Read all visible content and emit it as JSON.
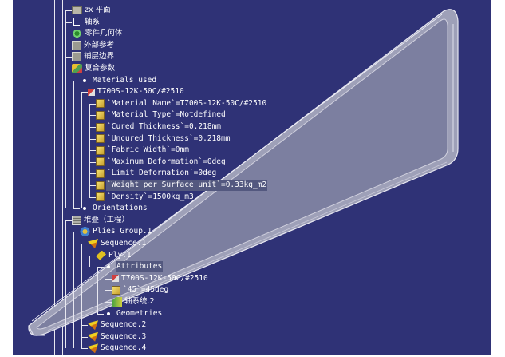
{
  "tree": {
    "nodes": [
      {
        "id": "zx-plane",
        "label": "zx 平面",
        "icon": "plane-icon",
        "indent": 0,
        "cn": true
      },
      {
        "id": "axis-system",
        "label": "轴系",
        "icon": "axis-icon",
        "indent": 0,
        "cn": true
      },
      {
        "id": "part-geometry",
        "label": "零件几何体",
        "icon": "gear-icon",
        "indent": 0,
        "cn": true
      },
      {
        "id": "external-refs",
        "label": "外部参考",
        "icon": "box-icon",
        "indent": 0,
        "cn": true
      },
      {
        "id": "ply-boundary",
        "label": "铺层边界",
        "icon": "box-icon",
        "indent": 0,
        "cn": true
      },
      {
        "id": "composite-params",
        "label": "复合参数",
        "icon": "composite-icon",
        "indent": 0,
        "cn": true
      },
      {
        "id": "materials-used",
        "label": "Materials used",
        "icon": "dot-icon",
        "indent": 1
      },
      {
        "id": "material-t700s",
        "label": "T700S-12K-50C/#2510",
        "icon": "material-icon",
        "indent": 2
      },
      {
        "id": "param-name",
        "label": "`Material Name`=T700S-12K-50C/#2510",
        "icon": "parameter-icon",
        "indent": 3
      },
      {
        "id": "param-type",
        "label": "`Material Type`=Notdefined",
        "icon": "parameter-icon",
        "indent": 3
      },
      {
        "id": "param-cured",
        "label": "`Cured Thickness`=0.218mm",
        "icon": "parameter-icon",
        "indent": 3
      },
      {
        "id": "param-uncured",
        "label": "`Uncured Thickness`=0.218mm",
        "icon": "parameter-icon",
        "indent": 3
      },
      {
        "id": "param-width",
        "label": "`Fabric Width`=0mm",
        "icon": "parameter-icon",
        "indent": 3
      },
      {
        "id": "param-maxdef",
        "label": "`Maximum Deformation`=0deg",
        "icon": "parameter-icon",
        "indent": 3
      },
      {
        "id": "param-limdef",
        "label": "`Limit Deformation`=0deg",
        "icon": "parameter-icon",
        "indent": 3
      },
      {
        "id": "param-weight",
        "label": "`Weight per Surface unit`=0.33kg_m2",
        "icon": "parameter-icon",
        "indent": 3,
        "selected": true
      },
      {
        "id": "param-density",
        "label": "`Density`=1500kg_m3",
        "icon": "parameter-icon",
        "indent": 3
      },
      {
        "id": "orientations",
        "label": "Orientations",
        "icon": "dot-icon",
        "indent": 1
      },
      {
        "id": "stacking",
        "label": "堆叠（工程）",
        "icon": "stack-icon",
        "indent": 0,
        "cn": true
      },
      {
        "id": "plies-group",
        "label": "Plies Group.1",
        "icon": "group-icon",
        "indent": 1
      },
      {
        "id": "sequence-1",
        "label": "Sequence.1",
        "icon": "sequence-icon",
        "indent": 2
      },
      {
        "id": "ply-1",
        "label": "Ply.1",
        "icon": "ply-icon",
        "indent": 3
      },
      {
        "id": "attributes",
        "label": "Attributes",
        "icon": "dot-icon",
        "indent": 4,
        "selected": true
      },
      {
        "id": "ply-material",
        "label": "T700S-12K-50C/#2510",
        "icon": "material-icon",
        "indent": 5
      },
      {
        "id": "ply-angle",
        "label": "`45`=45deg",
        "icon": "parameter-icon",
        "indent": 5
      },
      {
        "id": "ply-axis",
        "label": "轴系统.2",
        "icon": "axis-system-icon",
        "indent": 5,
        "cn": true
      },
      {
        "id": "geometries",
        "label": "Geometries",
        "icon": "dot-icon",
        "indent": 4
      },
      {
        "id": "sequence-2",
        "label": "Sequence.2",
        "icon": "sequence-icon",
        "indent": 2
      },
      {
        "id": "sequence-3",
        "label": "Sequence.3",
        "icon": "sequence-icon",
        "indent": 2
      },
      {
        "id": "sequence-4",
        "label": "Sequence.4",
        "icon": "sequence-icon",
        "indent": 2
      }
    ]
  },
  "colors": {
    "background": "#2f3276",
    "tree_text": "#ffffff",
    "selection": "#53587f",
    "part_face": "#7c7fa0",
    "part_edge": "#d8d8e4"
  }
}
